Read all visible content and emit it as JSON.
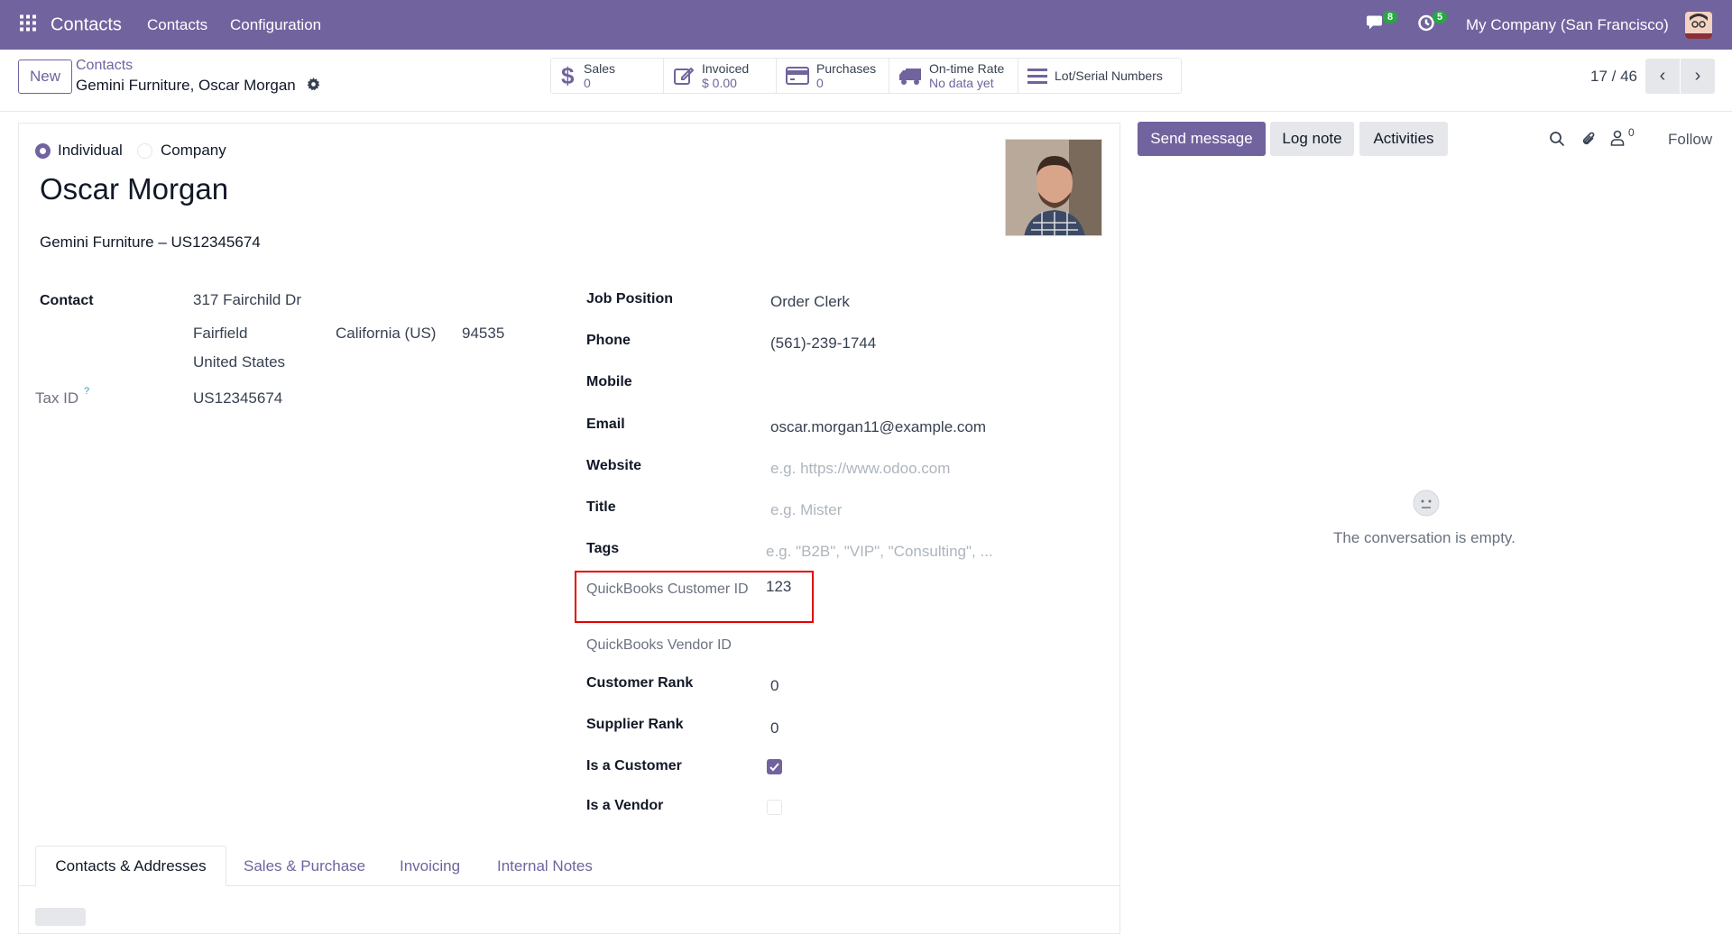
{
  "navbar": {
    "app_name": "Contacts",
    "menu": [
      "Contacts",
      "Configuration"
    ],
    "messages_badge": "8",
    "activities_badge": "5",
    "company": "My Company (San Francisco)",
    "colors": {
      "brand": "#71639e",
      "badge": "#28a745"
    }
  },
  "control_panel": {
    "new_label": "New",
    "breadcrumb_parent": "Contacts",
    "breadcrumb_current": "Gemini Furniture, Oscar Morgan",
    "pager": "17 / 46",
    "stats": [
      {
        "label": "Sales",
        "value": "0",
        "icon": "dollar-icon"
      },
      {
        "label": "Invoiced",
        "value": "$ 0.00",
        "icon": "edit-icon"
      },
      {
        "label": "Purchases",
        "value": "0",
        "icon": "credit-card-icon"
      },
      {
        "label": "On-time Rate",
        "value": "No data yet",
        "icon": "truck-icon"
      },
      {
        "label": "Lot/Serial Numbers",
        "icon": "list-icon"
      }
    ]
  },
  "form": {
    "type_options": [
      "Individual",
      "Company"
    ],
    "type_selected": "Individual",
    "name": "Oscar Morgan",
    "company_line": "Gemini Furniture – US12345674",
    "contact_label": "Contact",
    "street": "317 Fairchild Dr",
    "city": "Fairfield",
    "state": "California (US)",
    "zip": "94535",
    "country": "United States",
    "tax_id_label": "Tax ID",
    "tax_id_help": "?",
    "tax_id": "US12345674",
    "fields": {
      "job_position": {
        "label": "Job Position",
        "value": "Order Clerk"
      },
      "phone": {
        "label": "Phone",
        "value": "(561)-239-1744"
      },
      "mobile": {
        "label": "Mobile",
        "value": ""
      },
      "email": {
        "label": "Email",
        "value": "oscar.morgan11@example.com"
      },
      "website": {
        "label": "Website",
        "placeholder": "e.g. https://www.odoo.com"
      },
      "title": {
        "label": "Title",
        "placeholder": "e.g. Mister"
      },
      "tags": {
        "label": "Tags",
        "placeholder": "e.g. \"B2B\", \"VIP\", \"Consulting\", ..."
      },
      "qb_customer": {
        "label": "QuickBooks Customer ID",
        "value": "123"
      },
      "qb_vendor": {
        "label": "QuickBooks Vendor ID",
        "value": ""
      },
      "customer_rank": {
        "label": "Customer Rank",
        "value": "0"
      },
      "supplier_rank": {
        "label": "Supplier Rank",
        "value": "0"
      },
      "is_customer": {
        "label": "Is a Customer",
        "checked": true
      },
      "is_vendor": {
        "label": "Is a Vendor",
        "checked": false
      }
    },
    "tabs": [
      "Contacts & Addresses",
      "Sales & Purchase",
      "Invoicing",
      "Internal Notes"
    ],
    "active_tab": "Contacts & Addresses"
  },
  "chatter": {
    "send_message": "Send message",
    "log_note": "Log note",
    "activities": "Activities",
    "followers_count": "0",
    "follow": "Follow",
    "empty_text": "The conversation is empty."
  }
}
